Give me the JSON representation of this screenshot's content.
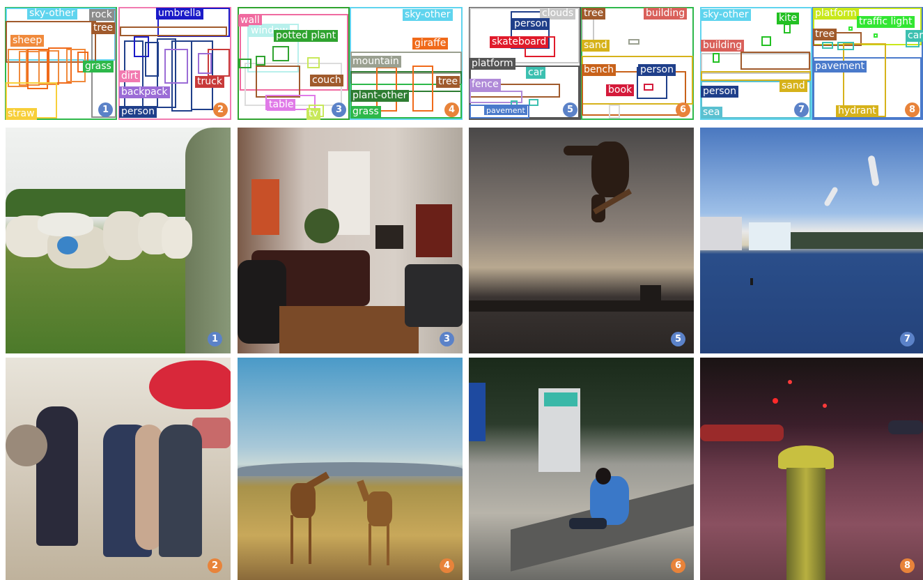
{
  "colors": {
    "badge_blue": "#5b82c8",
    "badge_orange": "#e8833a",
    "sky_other": "#5fd4ee",
    "rock": "#8c8c8c",
    "tree": "#a05a2c",
    "sheep": "#f08a3c",
    "grass": "#2db84a",
    "straw": "#f7cf3a",
    "umbrella": "#1a1ac8",
    "dirt": "#f17ab0",
    "backpack": "#9b6cd6",
    "person": "#1f3f8a",
    "truck": "#c83a3a",
    "wall": "#f06aa0",
    "window": "#b8f0ec",
    "potted_plant": "#2fa32f",
    "couch": "#a05a2c",
    "table": "#e07ae8",
    "tv": "#c8e85a",
    "giraffe": "#f06a1a",
    "mountain": "#9aa090",
    "plant_other": "#2e7d32",
    "clouds": "#c8c8c8",
    "skateboard": "#e01a2a",
    "platform": "#555555",
    "car": "#3cc0b0",
    "fence": "#b08ad8",
    "pavement": "#4a7acb",
    "building": "#d9605a",
    "sand": "#d6b21a",
    "bench": "#c8621a",
    "book": "#d41a3a",
    "kite": "#22c022",
    "sea": "#5ac0d0",
    "traffic_light": "#32e632",
    "hydrant": "#d6b21a"
  },
  "layouts": [
    {
      "id": "1",
      "badge": "1",
      "badge_color": "blue",
      "frame_color": "#2db84a",
      "labels": [
        {
          "text": "sky-other",
          "color": "#5fd4ee"
        },
        {
          "text": "rock",
          "color": "#8c8c8c"
        },
        {
          "text": "tree",
          "color": "#a05a2c"
        },
        {
          "text": "sheep",
          "color": "#f08a3c"
        },
        {
          "text": "grass",
          "color": "#2db84a"
        },
        {
          "text": "straw",
          "color": "#f7cf3a"
        }
      ]
    },
    {
      "id": "2",
      "badge": "2",
      "badge_color": "orange",
      "frame_color": "#f17ab0",
      "labels": [
        {
          "text": "umbrella",
          "color": "#1a1ac8"
        },
        {
          "text": "dirt",
          "color": "#f17ab0"
        },
        {
          "text": "backpack",
          "color": "#9b6cd6"
        },
        {
          "text": "truck",
          "color": "#c83a3a"
        },
        {
          "text": "person",
          "color": "#1f3f8a"
        }
      ]
    },
    {
      "id": "3",
      "badge": "3",
      "badge_color": "blue",
      "frame_color": "#2fa32f",
      "labels": [
        {
          "text": "wall",
          "color": "#f06aa0"
        },
        {
          "text": "window",
          "color": "#b8f0ec"
        },
        {
          "text": "potted plant",
          "color": "#2fa32f"
        },
        {
          "text": "couch",
          "color": "#a05a2c"
        },
        {
          "text": "table",
          "color": "#e07ae8"
        },
        {
          "text": "tv",
          "color": "#c8e85a"
        }
      ]
    },
    {
      "id": "4",
      "badge": "4",
      "badge_color": "orange",
      "frame_color": "#5fd4ee",
      "labels": [
        {
          "text": "sky-other",
          "color": "#5fd4ee"
        },
        {
          "text": "giraffe",
          "color": "#f06a1a"
        },
        {
          "text": "mountain",
          "color": "#9aa090"
        },
        {
          "text": "tree",
          "color": "#a05a2c"
        },
        {
          "text": "plant-other",
          "color": "#2e7d32"
        },
        {
          "text": "grass",
          "color": "#2db84a"
        }
      ]
    },
    {
      "id": "5",
      "badge": "5",
      "badge_color": "blue",
      "frame_color": "#555555",
      "labels": [
        {
          "text": "clouds",
          "color": "#c8c8c8"
        },
        {
          "text": "person",
          "color": "#1f3f8a"
        },
        {
          "text": "skateboard",
          "color": "#e01a2a"
        },
        {
          "text": "platform",
          "color": "#555555"
        },
        {
          "text": "car",
          "color": "#3cc0b0"
        },
        {
          "text": "fence",
          "color": "#b08ad8"
        },
        {
          "text": "pavement",
          "color": "#4a7acb"
        }
      ]
    },
    {
      "id": "6",
      "badge": "6",
      "badge_color": "orange",
      "frame_color": "#2db84a",
      "labels": [
        {
          "text": "tree",
          "color": "#a05a2c"
        },
        {
          "text": "building",
          "color": "#d9605a"
        },
        {
          "text": "sand",
          "color": "#d6b21a"
        },
        {
          "text": "bench",
          "color": "#c8621a"
        },
        {
          "text": "person",
          "color": "#1f3f8a"
        },
        {
          "text": "book",
          "color": "#d41a3a"
        }
      ]
    },
    {
      "id": "7",
      "badge": "7",
      "badge_color": "blue",
      "frame_color": "#5fd4ee",
      "labels": [
        {
          "text": "sky-other",
          "color": "#5fd4ee"
        },
        {
          "text": "kite",
          "color": "#22c022"
        },
        {
          "text": "building",
          "color": "#d9605a"
        },
        {
          "text": "person",
          "color": "#1f3f8a"
        },
        {
          "text": "sand",
          "color": "#d6b21a"
        },
        {
          "text": "sea",
          "color": "#5ac0d0"
        }
      ]
    },
    {
      "id": "8",
      "badge": "8",
      "badge_color": "orange",
      "frame_color": "#4a7acb",
      "labels": [
        {
          "text": "platform",
          "color": "#c8e81a"
        },
        {
          "text": "traffic light",
          "color": "#32e632"
        },
        {
          "text": "tree",
          "color": "#a05a2c"
        },
        {
          "text": "car",
          "color": "#3cc0b0"
        },
        {
          "text": "pavement",
          "color": "#4a7acb"
        },
        {
          "text": "hydrant",
          "color": "#d6b21a"
        }
      ]
    }
  ],
  "photos": [
    {
      "badge": "1",
      "badge_color": "blue",
      "scene": "sheep-meadow"
    },
    {
      "badge": "3",
      "badge_color": "blue",
      "scene": "living-room"
    },
    {
      "badge": "5",
      "badge_color": "blue",
      "scene": "skateboard-jump"
    },
    {
      "badge": "7",
      "badge_color": "blue",
      "scene": "kite-beach"
    },
    {
      "badge": "2",
      "badge_color": "orange",
      "scene": "beach-people-umbrella"
    },
    {
      "badge": "4",
      "badge_color": "orange",
      "scene": "giraffes-savanna"
    },
    {
      "badge": "6",
      "badge_color": "orange",
      "scene": "person-reading-bench"
    },
    {
      "badge": "8",
      "badge_color": "orange",
      "scene": "fire-hydrant-night"
    }
  ]
}
